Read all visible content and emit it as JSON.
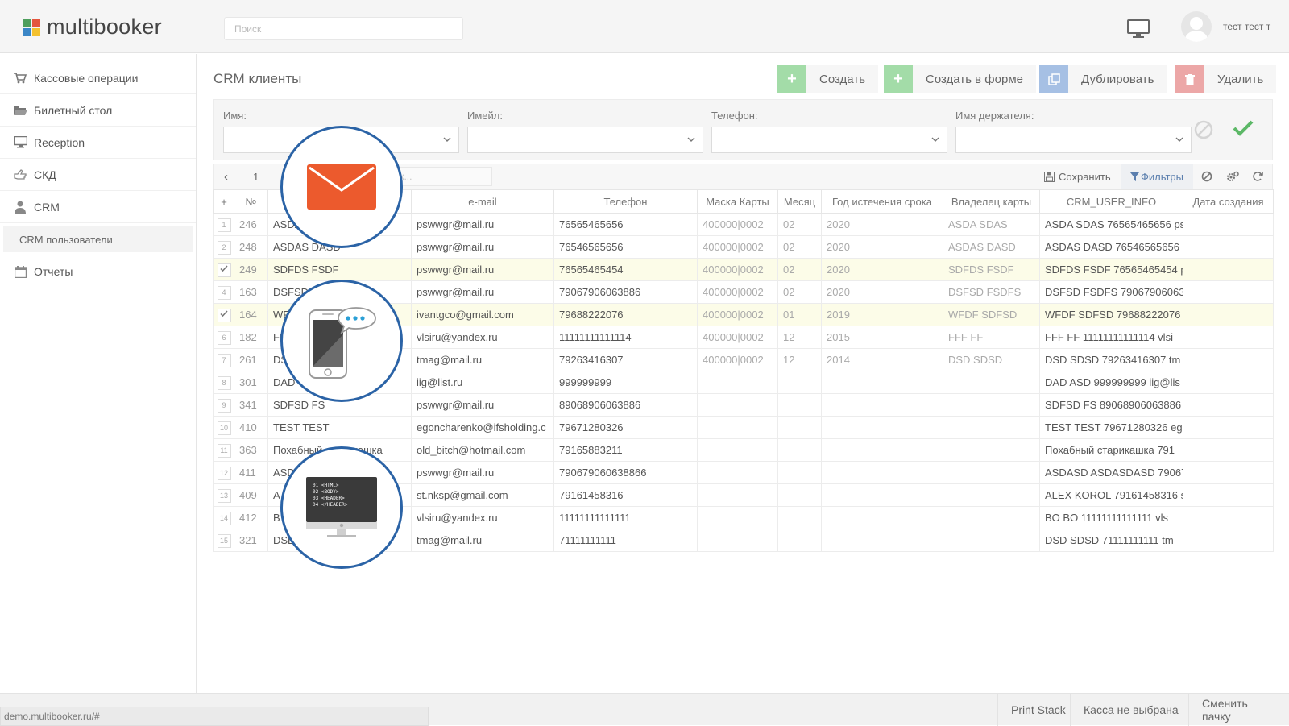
{
  "header": {
    "logo_text": "multibooker",
    "search_placeholder": "Поиск",
    "user_name": "тест тест т"
  },
  "sidebar": {
    "items": [
      {
        "label": "Кассовые операции",
        "icon": "cart-icon"
      },
      {
        "label": "Билетный стол",
        "icon": "folder-open-icon"
      },
      {
        "label": "Reception",
        "icon": "desktop-icon"
      },
      {
        "label": "СКД",
        "icon": "hand-pointer-icon"
      },
      {
        "label": "CRM",
        "icon": "user-icon"
      }
    ],
    "sub_item": "CRM пользователи",
    "reports": {
      "label": "Отчеты",
      "icon": "calendar-icon"
    }
  },
  "main": {
    "title": "CRM клиенты",
    "buttons": {
      "create": "Создать",
      "create_form": "Создать в форме",
      "duplicate": "Дублировать",
      "delete": "Удалить"
    },
    "filters": {
      "name": "Имя:",
      "email": "Имейл:",
      "phone": "Телефон:",
      "holder": "Имя держателя:"
    },
    "pager": {
      "page": "1"
    },
    "quick_search_placeholder": "Быстрый поиск...",
    "grid_toolbar": {
      "save": "Сохранить",
      "filters": "Фильтры"
    }
  },
  "table": {
    "columns": [
      "+",
      "№",
      "",
      "e-mail",
      "Телефон",
      "Маска Карты",
      "Месяц",
      "Год истечения срока",
      "Владелец карты",
      "CRM_USER_INFO",
      "Дата создания"
    ],
    "rows": [
      {
        "n": "1",
        "id": "246",
        "name": "ASDA",
        "email": "pswwgr@mail.ru",
        "phone": "76565465656",
        "mask": "400000|0002",
        "month": "02",
        "year": "2020",
        "owner": "ASDA SDAS",
        "info": "ASDA SDAS 76565465656 ps",
        "checked": false
      },
      {
        "n": "2",
        "id": "248",
        "name": "ASDAS DASD",
        "email": "pswwgr@mail.ru",
        "phone": "76546565656",
        "mask": "400000|0002",
        "month": "02",
        "year": "2020",
        "owner": "ASDAS DASD",
        "info": "ASDAS DASD 76546565656",
        "checked": false
      },
      {
        "n": "3",
        "id": "249",
        "name": "SDFDS FSDF",
        "email": "pswwgr@mail.ru",
        "phone": "76565465454",
        "mask": "400000|0002",
        "month": "02",
        "year": "2020",
        "owner": "SDFDS FSDF",
        "info": "SDFDS FSDF 76565465454 p",
        "checked": true
      },
      {
        "n": "4",
        "id": "163",
        "name": "DSFSD",
        "email": "pswwgr@mail.ru",
        "phone": "79067906063886",
        "mask": "400000|0002",
        "month": "02",
        "year": "2020",
        "owner": "DSFSD FSDFS",
        "info": "DSFSD FSDFS 79067906063",
        "checked": false
      },
      {
        "n": "5",
        "id": "164",
        "name": "WF",
        "email": "ivantgco@gmail.com",
        "phone": "79688222076",
        "mask": "400000|0002",
        "month": "01",
        "year": "2019",
        "owner": "WFDF SDFSD",
        "info": "WFDF SDFSD 79688222076",
        "checked": true
      },
      {
        "n": "6",
        "id": "182",
        "name": "FF",
        "email": "vlsiru@yandex.ru",
        "phone": "11111111111114",
        "mask": "400000|0002",
        "month": "12",
        "year": "2015",
        "owner": "FFF FF",
        "info": "FFF FF 11111111111114 vlsi",
        "checked": false
      },
      {
        "n": "7",
        "id": "261",
        "name": "DS",
        "email": "tmag@mail.ru",
        "phone": "79263416307",
        "mask": "400000|0002",
        "month": "12",
        "year": "2014",
        "owner": "DSD SDSD",
        "info": "DSD SDSD 79263416307 tm",
        "checked": false
      },
      {
        "n": "8",
        "id": "301",
        "name": "DAD",
        "email": "iig@list.ru",
        "phone": "999999999",
        "mask": "",
        "month": "",
        "year": "",
        "owner": "",
        "info": "DAD ASD 999999999 iig@lis",
        "checked": false
      },
      {
        "n": "9",
        "id": "341",
        "name": "SDFSD FS",
        "email": "pswwgr@mail.ru",
        "phone": "89068906063886",
        "mask": "",
        "month": "",
        "year": "",
        "owner": "",
        "info": "SDFSD FS 89068906063886",
        "checked": false
      },
      {
        "n": "10",
        "id": "410",
        "name": "TEST TEST",
        "email": "egoncharenko@ifsholding.c",
        "phone": "79671280326",
        "mask": "",
        "month": "",
        "year": "",
        "owner": "",
        "info": "TEST TEST 79671280326 eg",
        "checked": false
      },
      {
        "n": "11",
        "id": "363",
        "name": "Похабный старикашка",
        "email": "old_bitch@hotmail.com",
        "phone": "79165883211",
        "mask": "",
        "month": "",
        "year": "",
        "owner": "",
        "info": "Похабный старикашка 791",
        "checked": false
      },
      {
        "n": "12",
        "id": "411",
        "name": "ASD",
        "email": "pswwgr@mail.ru",
        "phone": "790679060638866",
        "mask": "",
        "month": "",
        "year": "",
        "owner": "",
        "info": "ASDASD ASDASDASD 79067",
        "checked": false
      },
      {
        "n": "13",
        "id": "409",
        "name": "A",
        "email": "st.nksp@gmail.com",
        "phone": "79161458316",
        "mask": "",
        "month": "",
        "year": "",
        "owner": "",
        "info": "ALEX KOROL 79161458316 s",
        "checked": false
      },
      {
        "n": "14",
        "id": "412",
        "name": "B",
        "email": "vlsiru@yandex.ru",
        "phone": "11111111111111",
        "mask": "",
        "month": "",
        "year": "",
        "owner": "",
        "info": "BO BO 11111111111111 vls",
        "checked": false
      },
      {
        "n": "15",
        "id": "321",
        "name": "DSD",
        "email": "tmag@mail.ru",
        "phone": "71111111111",
        "mask": "",
        "month": "",
        "year": "",
        "owner": "",
        "info": "DSD SDSD 71111111111 tm",
        "checked": false
      }
    ]
  },
  "overlays": {
    "icons": [
      "envelope-icon",
      "phone-chat-icon",
      "code-monitor-icon"
    ],
    "code_lines": [
      "01 <HTML>",
      "02 <BODY>",
      "03 <HEADER>",
      "04 </HEADER>"
    ]
  },
  "footer": {
    "status_url": "demo.multibooker.ru/#",
    "print_stack": "Print Stack",
    "cash_desk": "Касса не выбрана",
    "change_batch": "Сменить пачку"
  },
  "colors": {
    "green": "#a3dca8",
    "blue": "#a6c0e4",
    "red": "#eca7a7",
    "accent_circle": "#2b63a6",
    "envelope": "#ec5a2d",
    "selected_row": "#fcfce8"
  }
}
